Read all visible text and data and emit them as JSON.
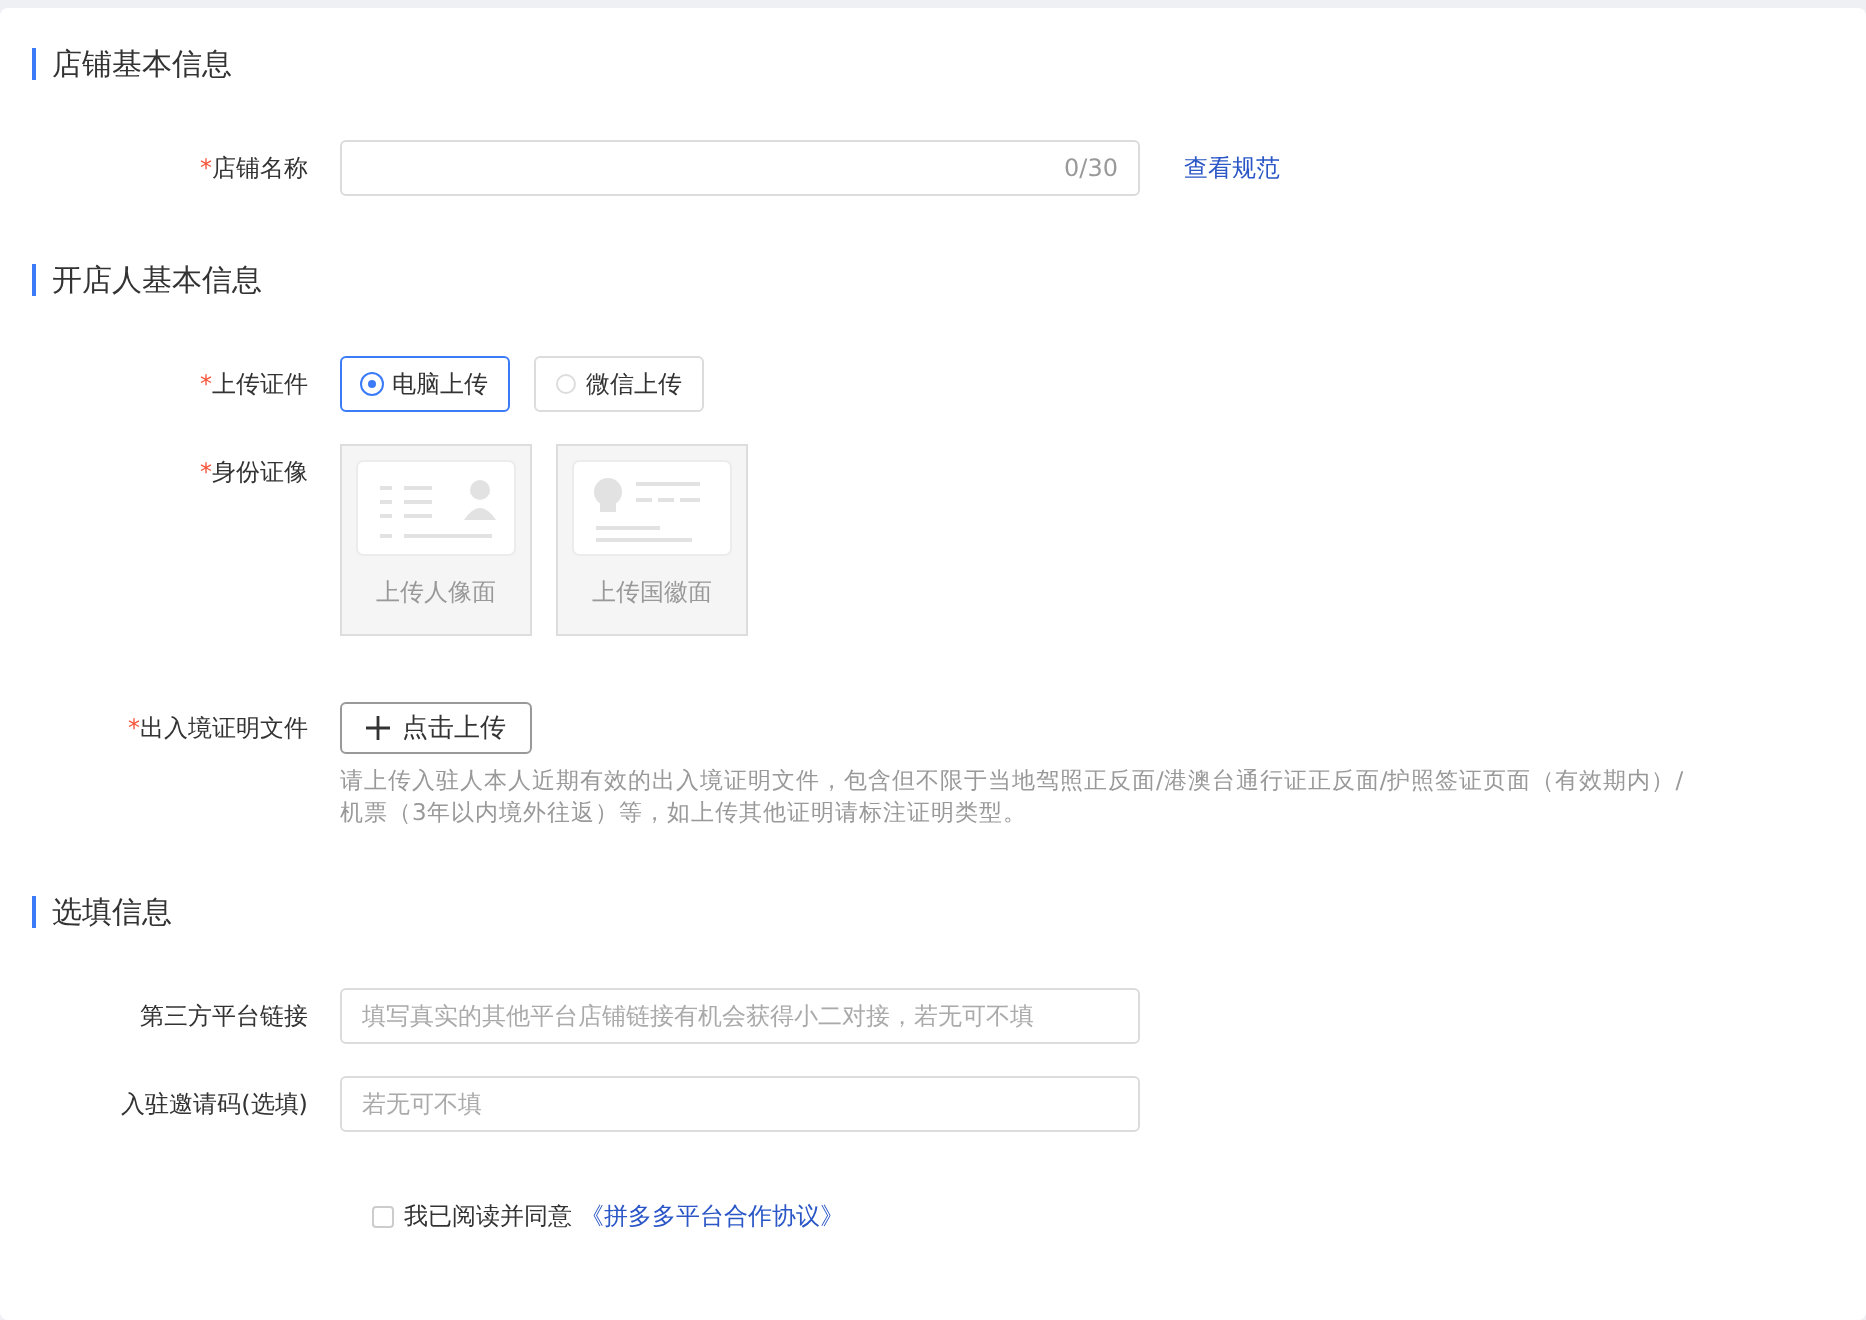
{
  "sections": [
    {
      "title": "店铺基本信息",
      "fields": [
        {
          "kind": "text",
          "mark": "*",
          "label": "店铺名称",
          "counter": "0/30",
          "link": "查看规范"
        }
      ]
    },
    {
      "title": "开店人基本信息",
      "fields": [
        {
          "kind": "radio",
          "mark": "*",
          "label": "上传证件",
          "options": [
            {
              "label": "电脑上传",
              "selected": true
            },
            {
              "label": "微信上传",
              "selected": false
            }
          ]
        },
        {
          "kind": "idcards",
          "mark": "*",
          "label": "身份证像",
          "cards": [
            {
              "kind": "portrait",
              "caption": "上传人像面"
            },
            {
              "kind": "emblem",
              "caption": "上传国徽面"
            }
          ]
        },
        {
          "kind": "upload",
          "mark": "*",
          "label": "出入境证明文件",
          "button": "点击上传",
          "help": "请上传入驻人本人近期有效的出入境证明文件，包含但不限于当地驾照正反面/港澳台通行证正反面/护照签证页面（有效期内）/机票（3年以内境外往返）等，如上传其他证明请标注证明类型。"
        }
      ]
    },
    {
      "title": "选填信息",
      "fields": [
        {
          "kind": "text",
          "label": "第三方平台链接",
          "placeholder": "填写真实的其他平台店铺链接有机会获得小二对接，若无可不填"
        },
        {
          "kind": "text",
          "label": "入驻邀请码(选填)",
          "placeholder": "若无可不填"
        }
      ]
    }
  ],
  "agreement": {
    "checked": false,
    "text": "我已阅读并同意",
    "link": "《拼多多平台合作协议》"
  }
}
